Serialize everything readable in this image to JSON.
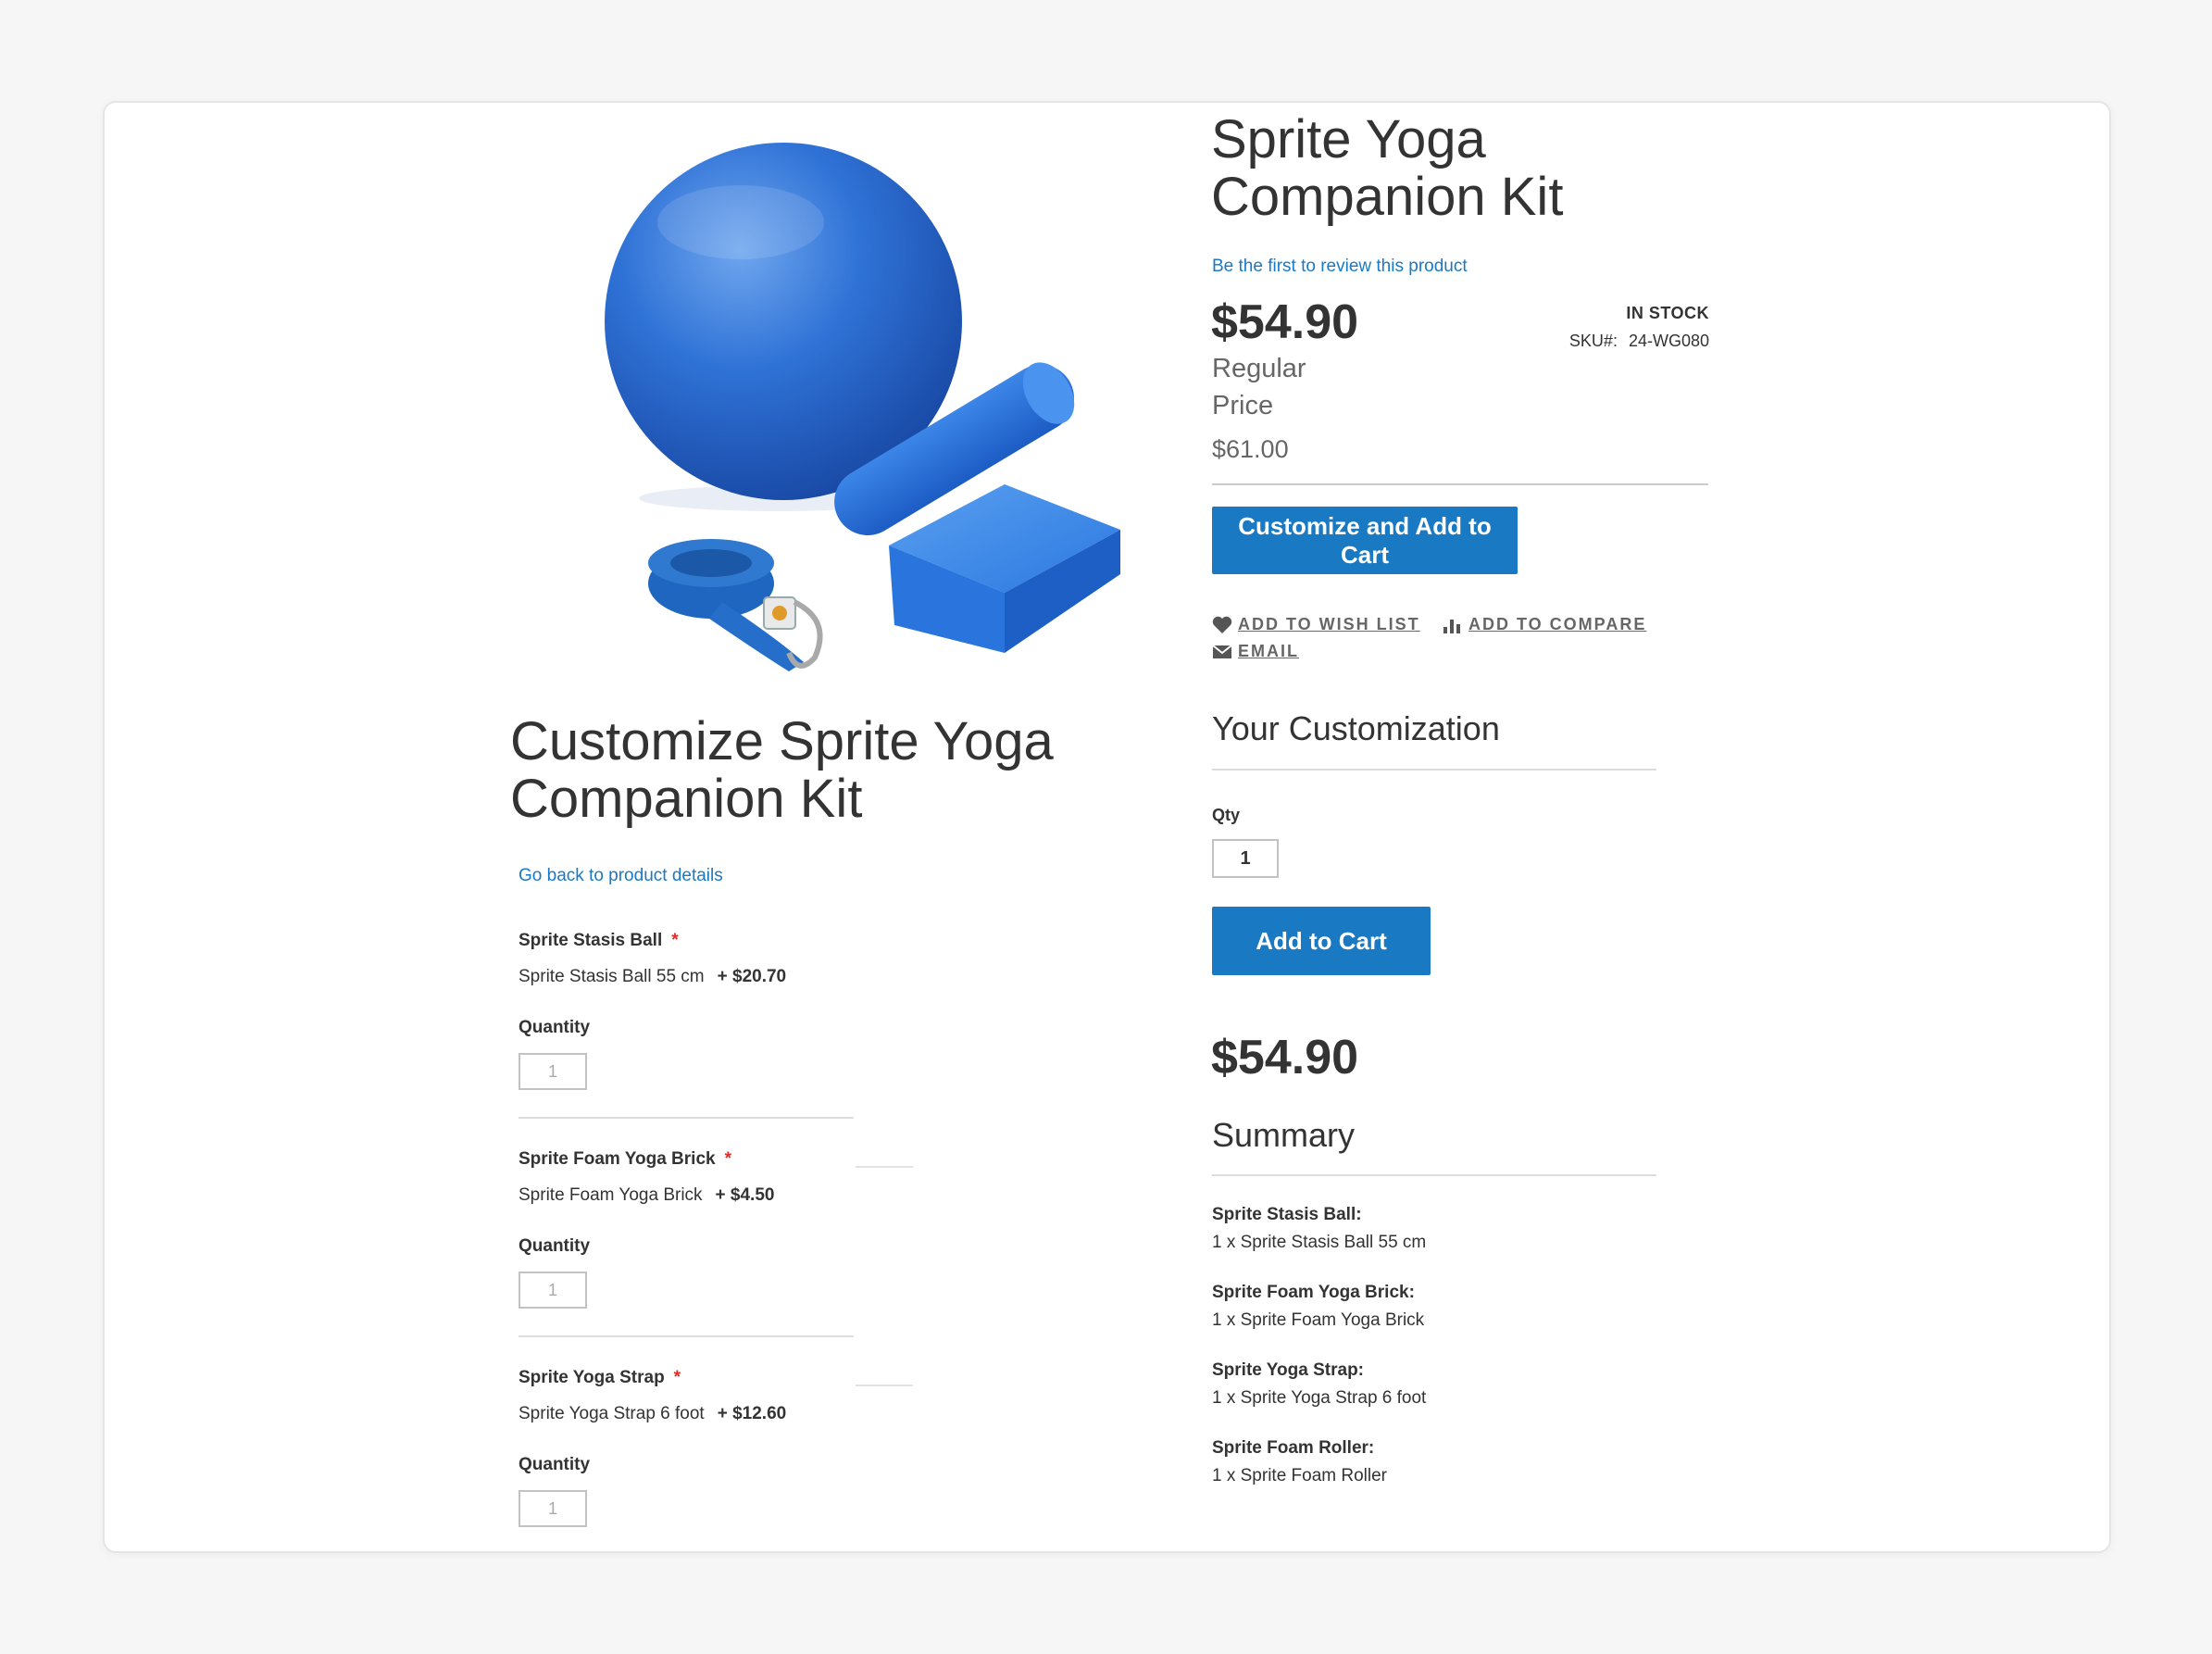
{
  "product": {
    "title": "Sprite Yoga Companion Kit",
    "review_link": "Be the first to review this product",
    "price": "$54.90",
    "regular_price_label": "Regular Price",
    "regular_price_value": "$61.00",
    "stock": "IN STOCK",
    "sku_label": "SKU#:",
    "sku_value": "24-WG080",
    "customize_button": "Customize and Add to Cart",
    "wishlist": "ADD TO WISH LIST",
    "compare": "ADD TO COMPARE",
    "email": "EMAIL"
  },
  "customization": {
    "heading": "Customize Sprite Yoga Companion Kit",
    "back_link": "Go back to product details",
    "quantity_label": "Quantity",
    "options": [
      {
        "title": "Sprite Stasis Ball",
        "required": "*",
        "choice": "Sprite Stasis Ball 55 cm",
        "price": "+ $20.70",
        "qty": "1"
      },
      {
        "title": "Sprite Foam Yoga Brick",
        "required": "*",
        "choice": "Sprite Foam Yoga Brick",
        "price": "+ $4.50",
        "qty": "1"
      },
      {
        "title": "Sprite Yoga Strap",
        "required": "*",
        "choice": "Sprite Yoga Strap 6 foot",
        "price": "+ $12.60",
        "qty": "1"
      }
    ]
  },
  "your_customization": {
    "title": "Your Customization",
    "qty_label": "Qty",
    "qty_value": "1",
    "add_to_cart": "Add to Cart",
    "total": "$54.90",
    "summary_title": "Summary",
    "summary": [
      {
        "name": "Sprite Stasis Ball:",
        "value": "1 x Sprite Stasis Ball 55 cm"
      },
      {
        "name": "Sprite Foam Yoga Brick:",
        "value": "1 x Sprite Foam Yoga Brick"
      },
      {
        "name": "Sprite Yoga Strap:",
        "value": "1 x Sprite Yoga Strap 6 foot"
      },
      {
        "name": "Sprite Foam Roller:",
        "value": "1 x Sprite Foam Roller"
      }
    ]
  },
  "icons": {
    "wishlist": "heart-icon",
    "compare": "bar-chart-icon",
    "email": "envelope-icon"
  },
  "colors": {
    "accent": "#1979c3",
    "required": "#e02b27",
    "background": "#f6f6f6"
  }
}
